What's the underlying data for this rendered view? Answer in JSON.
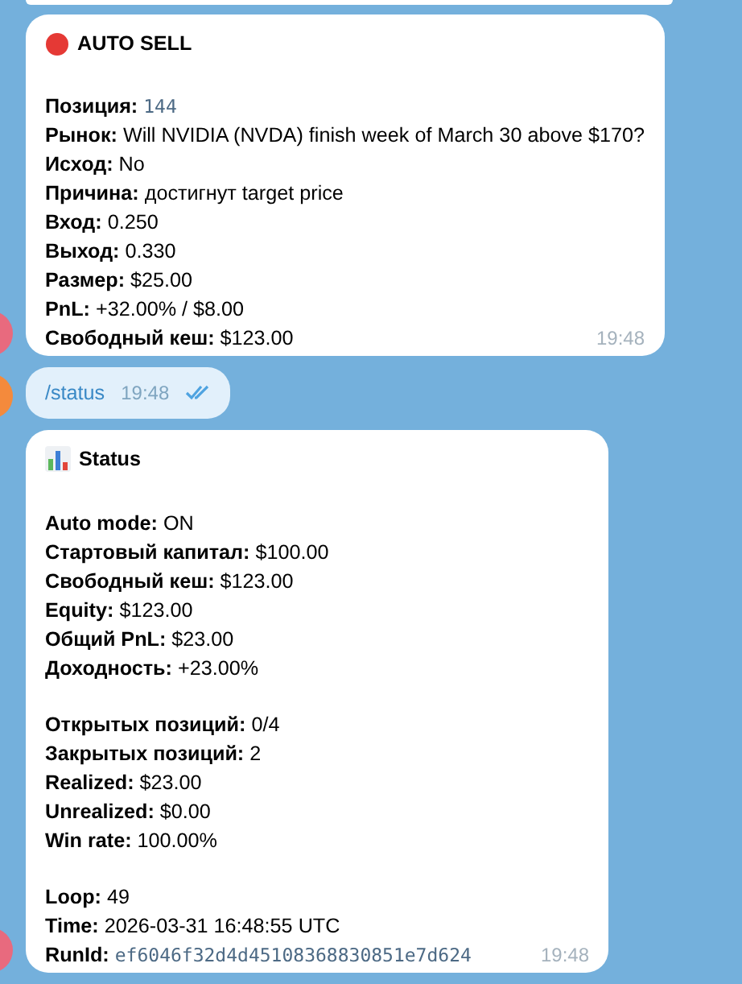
{
  "messages": [
    {
      "kind": "bot",
      "title": "AUTO SELL",
      "time": "19:48",
      "sections": [
        [
          {
            "label": "Позиция:",
            "value": "144",
            "kind": "code"
          },
          {
            "label": "Рынок:",
            "value": "Will NVIDIA (NVDA) finish week of March 30 above $170?",
            "kind": "text"
          },
          {
            "label": "Исход:",
            "value": "No",
            "kind": "text"
          },
          {
            "label": "Причина:",
            "value": "достигнут target price",
            "kind": "text"
          },
          {
            "label": "Вход:",
            "value": "0.250",
            "kind": "text"
          },
          {
            "label": "Выход:",
            "value": "0.330",
            "kind": "text"
          },
          {
            "label": "Размер:",
            "value": "$25.00",
            "kind": "text"
          },
          {
            "label": "PnL:",
            "value": "+32.00% / $8.00",
            "kind": "text"
          },
          {
            "label": "Свободный кеш:",
            "value": "$123.00",
            "kind": "text"
          }
        ]
      ]
    },
    {
      "kind": "user",
      "text": "/status",
      "time": "19:48",
      "read": true
    },
    {
      "kind": "bot",
      "title": "Status",
      "time": "19:48",
      "sections": [
        [
          {
            "label": "Auto mode:",
            "value": "ON",
            "kind": "text"
          },
          {
            "label": "Стартовый капитал:",
            "value": "$100.00",
            "kind": "text"
          },
          {
            "label": "Свободный кеш:",
            "value": "$123.00",
            "kind": "text"
          },
          {
            "label": "Equity:",
            "value": "$123.00",
            "kind": "text"
          },
          {
            "label": "Общий PnL:",
            "value": "$23.00",
            "kind": "text"
          },
          {
            "label": "Доходность:",
            "value": "+23.00%",
            "kind": "text"
          }
        ],
        [
          {
            "label": "Открытых позиций:",
            "value": "0/4",
            "kind": "text"
          },
          {
            "label": "Закрытых позиций:",
            "value": "2",
            "kind": "text"
          },
          {
            "label": "Realized:",
            "value": "$23.00",
            "kind": "text"
          },
          {
            "label": "Unrealized:",
            "value": "$0.00",
            "kind": "text"
          },
          {
            "label": "Win rate:",
            "value": "100.00%",
            "kind": "text"
          }
        ],
        [
          {
            "label": "Loop:",
            "value": "49",
            "kind": "text"
          },
          {
            "label": "Time:",
            "value": "2026-03-31 16:48:55 UTC",
            "kind": "text"
          },
          {
            "label": "RunId:",
            "value": "ef6046f32d4d45108368830851e7d624",
            "kind": "code"
          }
        ]
      ]
    }
  ]
}
